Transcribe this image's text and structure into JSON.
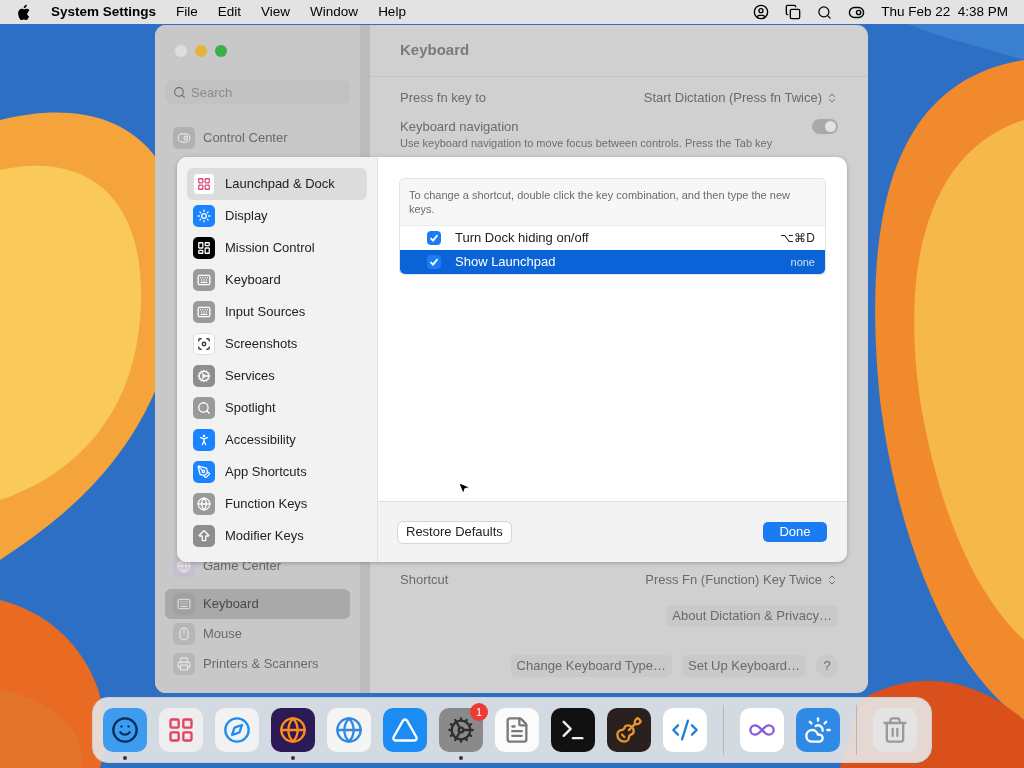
{
  "menu_bar": {
    "app_name": "System Settings",
    "menus": [
      "File",
      "Edit",
      "View",
      "Window",
      "Help"
    ],
    "clock": "Thu Feb 22  4:38 PM"
  },
  "window": {
    "title": "Keyboard",
    "search": {
      "placeholder": "Search"
    },
    "sidebar_top": [
      {
        "kind": "control",
        "label": "Control Center",
        "selected": false
      }
    ],
    "sidebar_bottom": [
      {
        "kind": "game",
        "label": "Game Center",
        "selected": false
      },
      {
        "kind": "keyboard",
        "label": "Keyboard",
        "selected": true
      },
      {
        "kind": "mouse",
        "label": "Mouse",
        "selected": false
      },
      {
        "kind": "printer",
        "label": "Printers & Scanners",
        "selected": false
      }
    ],
    "settings": [
      {
        "kind": "popup",
        "label": "Press fn key to",
        "value": "Start Dictation (Press fn Twice)"
      },
      {
        "kind": "toggle",
        "label": "Keyboard navigation",
        "on": true,
        "description": "Use keyboard navigation to move focus between controls. Press the Tab key"
      }
    ],
    "dictation": {
      "label": "Shortcut",
      "value": "Press Fn (Function) Key Twice"
    },
    "about_button": "About Dictation & Privacy…",
    "footer_buttons": [
      "Change Keyboard Type…",
      "Set Up Keyboard…"
    ],
    "help": "?"
  },
  "sheet": {
    "sidebar": [
      {
        "kind": "launchpad",
        "label": "Launchpad & Dock",
        "selected": true
      },
      {
        "kind": "display",
        "label": "Display",
        "selected": false
      },
      {
        "kind": "mission",
        "label": "Mission Control",
        "selected": false
      },
      {
        "kind": "keyboard",
        "label": "Keyboard",
        "selected": false
      },
      {
        "kind": "input",
        "label": "Input Sources",
        "selected": false
      },
      {
        "kind": "screenshots",
        "label": "Screenshots",
        "selected": false
      },
      {
        "kind": "services",
        "label": "Services",
        "selected": false
      },
      {
        "kind": "spotlight",
        "label": "Spotlight",
        "selected": false
      },
      {
        "kind": "accessibility",
        "label": "Accessibility",
        "selected": false
      },
      {
        "kind": "appshortcuts",
        "label": "App Shortcuts",
        "selected": false
      },
      {
        "kind": "function",
        "label": "Function Keys",
        "selected": false
      },
      {
        "kind": "modifier",
        "label": "Modifier Keys",
        "selected": false
      }
    ],
    "hint": "To change a shortcut, double click the key combination, and then type the new keys.",
    "shortcuts": [
      {
        "label": "Turn Dock hiding on/off",
        "keys": "⌥⌘D",
        "checked": true,
        "selected": false
      },
      {
        "label": "Show Launchpad",
        "keys": "none",
        "checked": true,
        "selected": true
      }
    ],
    "restore_button": "Restore Defaults",
    "done_button": "Done"
  },
  "dock": [
    {
      "kind": "finder",
      "running": true
    },
    {
      "kind": "launchpad",
      "running": false
    },
    {
      "kind": "safari",
      "running": false
    },
    {
      "kind": "firefox",
      "running": true
    },
    {
      "kind": "chrome",
      "running": false
    },
    {
      "kind": "appstore",
      "running": false
    },
    {
      "kind": "settings",
      "running": true,
      "badge": "1"
    },
    {
      "kind": "textedit",
      "running": false
    },
    {
      "kind": "terminal",
      "running": false
    },
    {
      "kind": "garageband",
      "running": false
    },
    {
      "kind": "vscode",
      "running": false
    },
    {
      "kind": "divider"
    },
    {
      "kind": "visualstudio",
      "running": false
    },
    {
      "kind": "weather",
      "running": false
    },
    {
      "kind": "divider"
    },
    {
      "kind": "trash",
      "running": false
    }
  ]
}
